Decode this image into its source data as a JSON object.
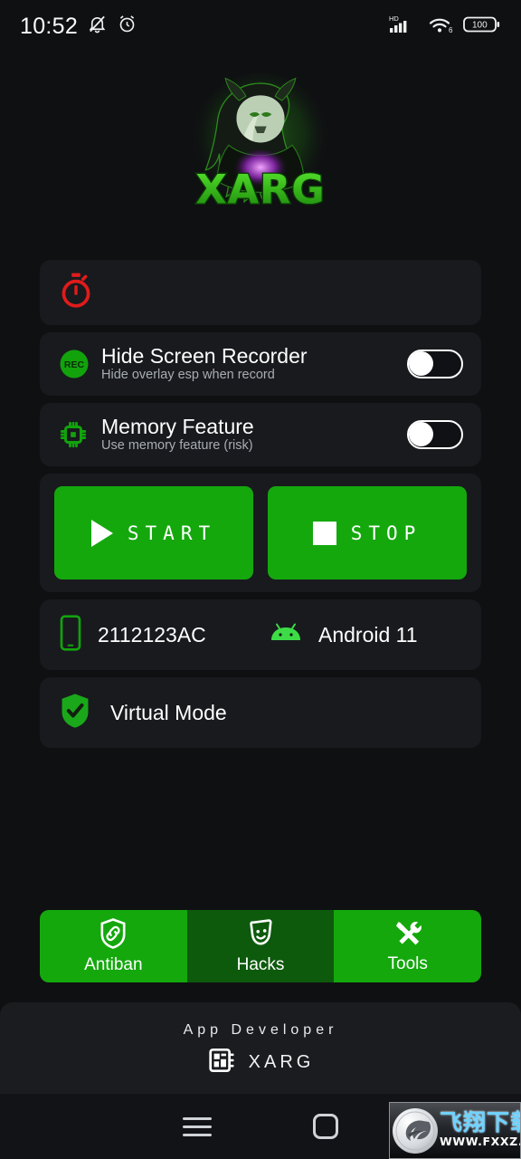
{
  "status_bar": {
    "time": "10:52",
    "icons_left": [
      "bell-off-icon",
      "alarm-clock-icon"
    ],
    "network_label": "HD",
    "wifi_label": "6",
    "battery_level": "100"
  },
  "logo": {
    "brand_text": "XARG",
    "alt": "xarg-predator-logo",
    "glow_color": "#3bd119"
  },
  "timer_card": {
    "icon": "stopwatch-icon",
    "icon_color": "#e01b1b",
    "value": ""
  },
  "settings": [
    {
      "icon": "rec-icon",
      "icon_text": "REC",
      "title": "Hide Screen Recorder",
      "subtitle": "Hide overlay esp when record",
      "toggle_on": false
    },
    {
      "icon": "cpu-chip-icon",
      "title": "Memory Feature",
      "subtitle": "Use memory feature (risk)",
      "toggle_on": false
    }
  ],
  "actions": {
    "start_label": "START",
    "stop_label": "STOP",
    "start_icon": "play-icon",
    "stop_icon": "stop-square-icon",
    "button_color": "#14a80d"
  },
  "device": {
    "phone_icon": "smartphone-icon",
    "model": "2112123AC",
    "os_icon": "android-icon",
    "os_version": "Android 11"
  },
  "virtual_mode": {
    "icon": "shield-check-icon",
    "label": "Virtual Mode"
  },
  "tabs": [
    {
      "label": "Antiban",
      "icon": "shield-link-icon",
      "active": true
    },
    {
      "label": "Hacks",
      "icon": "theater-mask-icon",
      "active": false
    },
    {
      "label": "Tools",
      "icon": "wrench-screwdriver-icon",
      "active": true
    }
  ],
  "footer": {
    "developer_label": "App Developer",
    "developer_icon": "microchip-icon",
    "developer_name": "XARG"
  },
  "nav_bar": {
    "recents_icon": "hamburger-icon",
    "home_icon": "home-square-icon"
  },
  "watermark": {
    "cn_text": "飞翔下载",
    "url_text": "WWW.FXXZ.COM",
    "accent_color": "#6fd2ff"
  }
}
